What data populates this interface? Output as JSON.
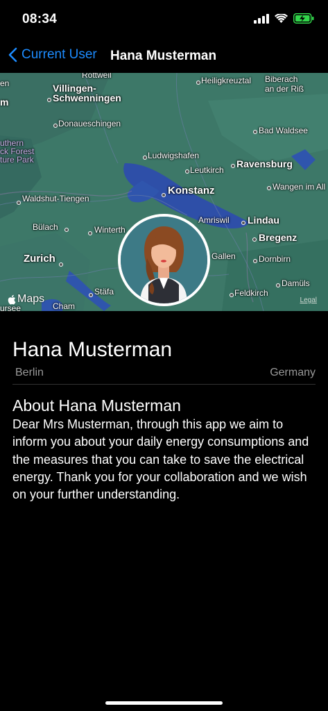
{
  "status": {
    "time": "08:34",
    "signal_icon": "cellular-signal-icon",
    "wifi_icon": "wifi-icon",
    "battery_icon": "battery-charging-icon",
    "battery_color": "#32d74b"
  },
  "nav": {
    "back_label": "Current User",
    "title": "Hana Musterman",
    "accent": "#1d8cff"
  },
  "map": {
    "labels": {
      "rottweil": "Rottweil",
      "villingen": "Villingen-",
      "schwenningen": "Schwenningen",
      "donaueschingen": "Donaueschingen",
      "heiligkreuztal": "Heiligkreuztal",
      "biberach": "Biberach",
      "an_der_riss": "an der Riß",
      "bad_waldsee": "Bad Waldsee",
      "black_forest1": "uthern",
      "black_forest2": "ck Forest",
      "black_forest3": "ture Park",
      "ludwigshafen": "Ludwigshafen",
      "leutkirch": "Leutkirch",
      "ravensburg": "Ravensburg",
      "konstanz": "Konstanz",
      "wangen": "Wangen im All",
      "waldshut": "Waldshut-Tiengen",
      "amriswil": "Amriswil",
      "lindau": "Lindau",
      "bulach": "Bülach",
      "winterthur": "Winterth",
      "bregenz": "Bregenz",
      "zurich": "Zurich",
      "gallen": "Gallen",
      "dornbirn": "Dornbirn",
      "stafa": "Stäfa",
      "damuls": "Damüls",
      "feldkirch": "Feldkirch",
      "cham": "Cham",
      "ursee": "ursee",
      "en_left": "en",
      "m_left": "m"
    },
    "attribution": "Maps",
    "legal": "Legal"
  },
  "profile": {
    "name": "Hana Musterman",
    "city": "Berlin",
    "country": "Germany"
  },
  "about": {
    "title": "About Hana Musterman",
    "text": "Dear Mrs Musterman, through this app we aim to inform you about your daily energy consumptions and the measures that you can take to save the electrical energy. Thank you for your collaboration and we wish on your further understanding."
  }
}
